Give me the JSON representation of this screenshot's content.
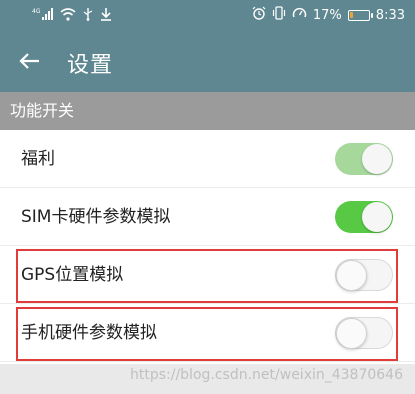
{
  "status_bar": {
    "left_icons": [
      "signal-4g-icon",
      "wifi-icon",
      "usb-icon",
      "download-icon"
    ],
    "signal_label": "4G",
    "battery_percent_text": "17%",
    "battery_level": 0.17,
    "time": "8:33",
    "right_icons": [
      "alarm-icon",
      "vibrate-icon",
      "speed-icon",
      "battery-icon"
    ]
  },
  "toolbar": {
    "back_icon": "arrow-left-icon",
    "title": "设置"
  },
  "section": {
    "header": "功能开关"
  },
  "settings": [
    {
      "label": "福利",
      "state": "on",
      "tint": "light"
    },
    {
      "label": "SIM卡硬件参数模拟",
      "state": "on",
      "tint": "strong"
    },
    {
      "label": "GPS位置模拟",
      "state": "off"
    },
    {
      "label": "手机硬件参数模拟",
      "state": "off"
    }
  ],
  "colors": {
    "toolbar": "#5f8791",
    "section_header": "#9b9b9b",
    "switch_on_light": "#a6d89b",
    "switch_on_strong": "#58c945",
    "switch_off_bg": "#f5f5f5",
    "highlight_border": "#e23b3b"
  },
  "watermark": "https://blog.csdn.net/weixin_43870646"
}
